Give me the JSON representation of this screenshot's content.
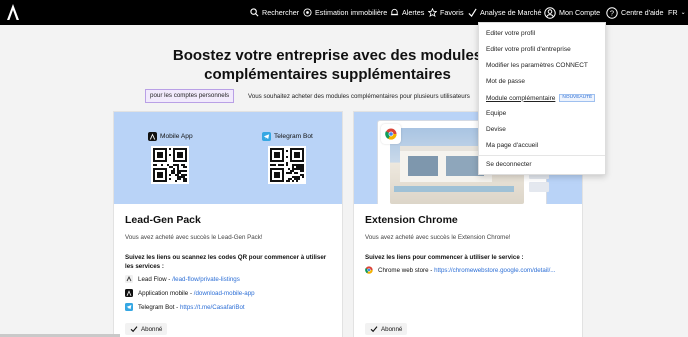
{
  "nav": {
    "items": [
      {
        "label": "Rechercher",
        "icon": "search-icon"
      },
      {
        "label": "Estimation immobilière",
        "icon": "estimation-icon"
      },
      {
        "label": "Alertes",
        "icon": "bell-icon"
      },
      {
        "label": "Favoris",
        "icon": "star-icon"
      },
      {
        "label": "Analyse de Marché",
        "icon": "chart-check-icon"
      },
      {
        "label": "Mon Compte",
        "icon": "user-circle-icon"
      },
      {
        "label": "Centre d'aide",
        "icon": "help-circle-icon"
      }
    ],
    "language": "FR"
  },
  "main": {
    "title": "Boostez votre entreprise avec des modules complémentaires supplémentaires",
    "toggle_label": "pour les comptes personnels",
    "toggle_text": "Vous souhaitez acheter des modules complémentaires pour plusieurs utilisateurs"
  },
  "cards": [
    {
      "title": "Lead-Gen Pack",
      "subtitle": "Vous avez acheté avec succès le Lead-Gen Pack!",
      "instructions": "Suivez les liens ou scannez les codes QR pour commencer à utiliser les services :",
      "apps": [
        {
          "label": "Mobile App",
          "icon": "casafari-app-icon"
        },
        {
          "label": "Telegram Bot",
          "icon": "telegram-icon"
        }
      ],
      "links": [
        {
          "name": "Lead Flow",
          "sep": " - ",
          "url": "/lead-flow/private-listings",
          "icon": "lead-flow-icon"
        },
        {
          "name": "Application mobile",
          "sep": " - ",
          "url": "/download-mobile-app",
          "icon": "casafari-app-icon"
        },
        {
          "name": "Telegram Bot",
          "sep": " - ",
          "url": "https://t.me/CasafariBot",
          "icon": "telegram-icon"
        }
      ],
      "status": "Abonné"
    },
    {
      "title": "Extension Chrome",
      "subtitle": "Vous avez acheté avec succès le Extension Chrome!",
      "instructions": "Suivez les liens pour commencer à utiliser le service :",
      "links": [
        {
          "name": "Chrome web store",
          "sep": " - ",
          "url": "https://chromewebstore.google.com/detail/...",
          "icon": "chrome-icon"
        }
      ],
      "status": "Abonné"
    }
  ],
  "account_menu": {
    "items": [
      "Editer votre profil",
      "Editer votre profil d'entreprise",
      "Modifier les paramètres CONNECT",
      "Mot de passe",
      "Module complémentaire",
      "Equipe",
      "Devise",
      "Ma page d'accueil",
      "Se deconnecter"
    ],
    "new_badge": "NOUVEAUTÉ"
  },
  "colors": {
    "nav_bg": "#000000",
    "hero_bg": "#b9d3f7",
    "link": "#2d6fd6",
    "toggle_border": "#b9a0e6"
  }
}
